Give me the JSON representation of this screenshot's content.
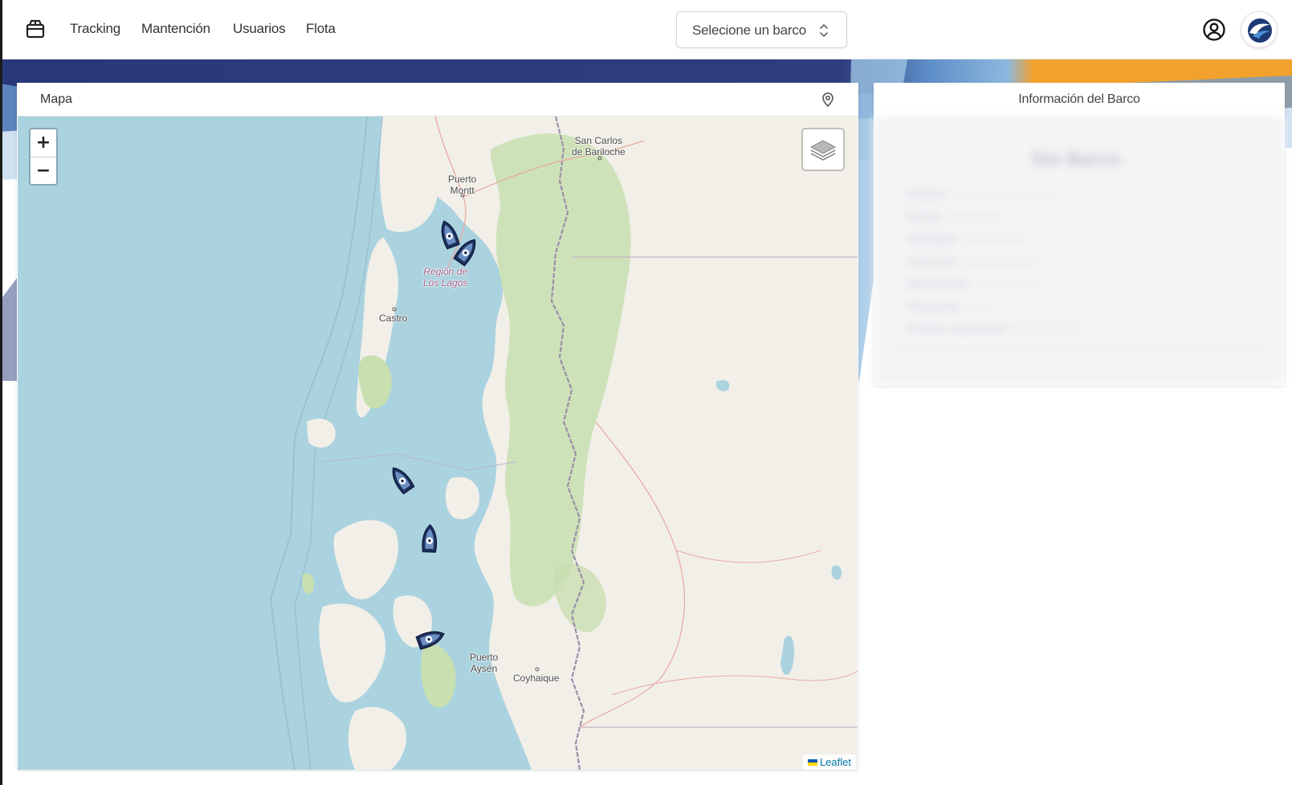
{
  "nav": {
    "logo_icon": "package-box-icon",
    "links": [
      "Tracking",
      "Mantención",
      "Usuarios",
      "Flota"
    ],
    "boat_select_value": "Selecione un barco",
    "user_icon": "user-circle-icon",
    "avatar_icon": "company-logo-icon"
  },
  "colors": {
    "banner_navy": "#2e3d7e",
    "banner_blue": "#5f9ad3",
    "banner_orange": "#f2a12c",
    "marker_navy": "#1e2f5b",
    "map_water": "#aad3df",
    "map_land": "#f2efe9",
    "map_forest": "#c8dfb0"
  },
  "map": {
    "title": "Mapa",
    "header_icon": "map-pin-icon",
    "zoom_in": "+",
    "zoom_out": "−",
    "layers_icon": "layers-icon",
    "attribution": "Leaflet",
    "places": {
      "san_carlos_1": "San Carlos",
      "san_carlos_2": "de Bariloche",
      "puerto_montt_1": "Puerto",
      "puerto_montt_2": "Montt",
      "region_1": "Región de",
      "region_2": "Los Lagos",
      "castro": "Castro",
      "puerto_aysen_1": "Puerto",
      "puerto_aysen_2": "Aysén",
      "coyhaique": "Coyhaique"
    },
    "boat_marker_icon": "boat-icon",
    "boat_count": 5
  },
  "info": {
    "title": "Información del Barco",
    "blurred_heading": "Sin Barco",
    "blurred_lines": [
      "Nombre: —————————",
      "Estado: —————",
      "Velocidad: ——————",
      "Ubicación: ———————",
      "Última señal: ——————",
      "Tripulación: ——",
      "Próxima mantención: ——————"
    ]
  }
}
